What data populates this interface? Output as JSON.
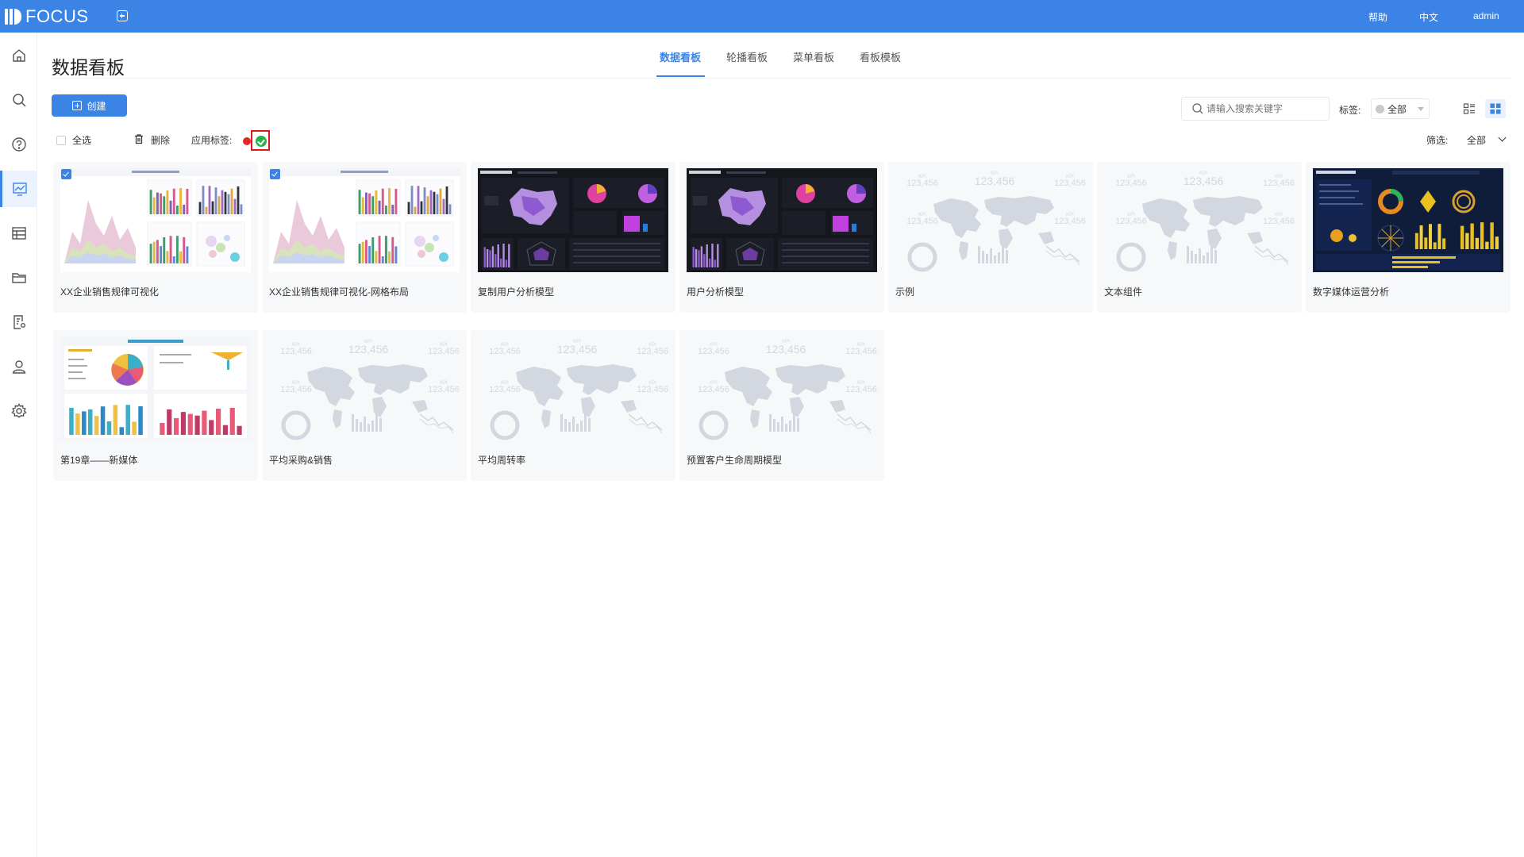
{
  "app": {
    "logo_text": "FOCUS"
  },
  "topnav": {
    "help": "帮助",
    "language": "中文",
    "user": "admin"
  },
  "page": {
    "title": "数据看板"
  },
  "tabs": [
    {
      "label": "数据看板",
      "active": true
    },
    {
      "label": "轮播看板",
      "active": false
    },
    {
      "label": "菜单看板",
      "active": false
    },
    {
      "label": "看板模板",
      "active": false
    }
  ],
  "toolbar": {
    "create_label": "创建",
    "search_placeholder": "请输入搜索关键字",
    "tag_label": "标签:",
    "tag_value": "全部",
    "select_all_label": "全选",
    "delete_label": "删除",
    "apply_tag_label": "应用标签:",
    "filter_label": "筛选:",
    "filter_value": "全部"
  },
  "sidebar": {
    "items": [
      {
        "icon": "home-icon"
      },
      {
        "icon": "search-icon"
      },
      {
        "icon": "help-icon"
      },
      {
        "icon": "dashboard-icon",
        "active": true
      },
      {
        "icon": "table-icon"
      },
      {
        "icon": "folder-icon"
      },
      {
        "icon": "report-settings-icon"
      },
      {
        "icon": "user-icon"
      },
      {
        "icon": "settings-icon"
      }
    ]
  },
  "kpi_placeholder": {
    "kpi": "KPI",
    "value": "123,456"
  },
  "cards": [
    {
      "title": "XX企业销售规律可视化",
      "thumb": "light-dashboard",
      "checked": true
    },
    {
      "title": "XX企业销售规律可视化-网格布局",
      "thumb": "light-dashboard",
      "checked": true
    },
    {
      "title": "复制用户分析模型",
      "thumb": "dark-dashboard",
      "checked": false
    },
    {
      "title": "用户分析模型",
      "thumb": "dark-dashboard",
      "checked": false
    },
    {
      "title": "示例",
      "thumb": "placeholder",
      "checked": false
    },
    {
      "title": "文本组件",
      "thumb": "placeholder",
      "checked": false
    },
    {
      "title": "数字媒体运营分析",
      "thumb": "navy-dashboard",
      "checked": false
    },
    {
      "title": "第19章——新媒体",
      "thumb": "media-dashboard",
      "checked": false
    },
    {
      "title": "平均采购&销售",
      "thumb": "placeholder",
      "checked": false
    },
    {
      "title": "平均周转率",
      "thumb": "placeholder",
      "checked": false
    },
    {
      "title": "预置客户生命周期模型",
      "thumb": "placeholder",
      "checked": false
    }
  ],
  "colors": {
    "accent": "#3b84e6",
    "tag_red": "#e02828",
    "tag_green": "#27b14a"
  }
}
